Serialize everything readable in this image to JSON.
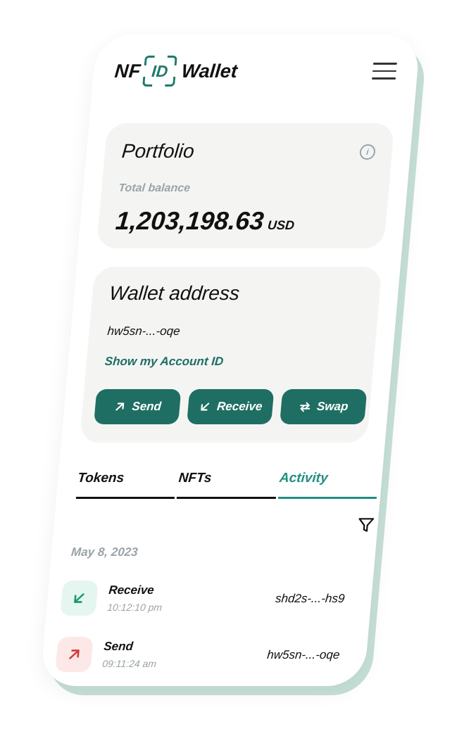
{
  "header": {
    "logo_nf": "NF",
    "logo_id": "ID",
    "logo_wallet": "Wallet",
    "menu_icon": "hamburger-menu-icon"
  },
  "portfolio": {
    "title": "Portfolio",
    "info_icon_glyph": "i",
    "balance_label": "Total balance",
    "balance_value": "1,203,198.63",
    "balance_currency": "USD"
  },
  "wallet": {
    "title": "Wallet address",
    "address": "hw5sn-...-oqe",
    "account_link": "Show my Account ID",
    "actions": [
      {
        "label": "Send",
        "icon": "arrow-up-right-icon"
      },
      {
        "label": "Receive",
        "icon": "arrow-down-left-icon"
      },
      {
        "label": "Swap",
        "icon": "swap-arrows-icon"
      }
    ]
  },
  "tabs": [
    {
      "label": "Tokens",
      "active": false
    },
    {
      "label": "NFTs",
      "active": false
    },
    {
      "label": "Activity",
      "active": true
    }
  ],
  "activity": {
    "filter_icon": "filter-funnel-icon",
    "date": "May 8, 2023",
    "transactions": [
      {
        "type": "Receive",
        "time": "10:12:10 pm",
        "address": "shd2s-...-hs9",
        "direction": "in"
      },
      {
        "type": "Send",
        "time": "09:11:24 am",
        "address": "hw5sn-...-oqe",
        "direction": "out"
      }
    ]
  },
  "colors": {
    "accent": "#1f6e63",
    "accent_tab": "#1f8f80",
    "card_bg": "#f4f5f3",
    "shadow": "#c6e0d8",
    "muted": "#9aa3a8",
    "receive_bg": "#e4f6ef",
    "receive_icon": "#1a9a6c",
    "send_bg": "#fde8e8",
    "send_icon": "#d63a3a"
  }
}
